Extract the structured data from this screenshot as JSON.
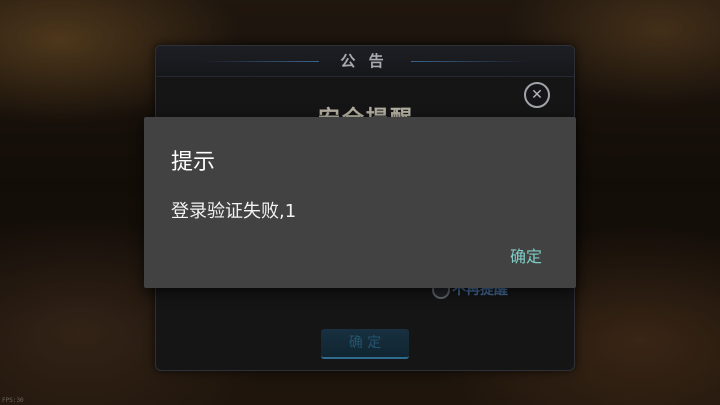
{
  "background": {
    "corner_tag": "FPS:30"
  },
  "notice_panel": {
    "title": "公 告",
    "heading": "安全提醒",
    "close_icon": "close-icon",
    "dont_remind_label": "不再提醒",
    "confirm_label": "确 定"
  },
  "dialog": {
    "title": "提示",
    "message": "登录验证失败,1",
    "ok_label": "确定",
    "accent_color": "#80cbc4"
  }
}
